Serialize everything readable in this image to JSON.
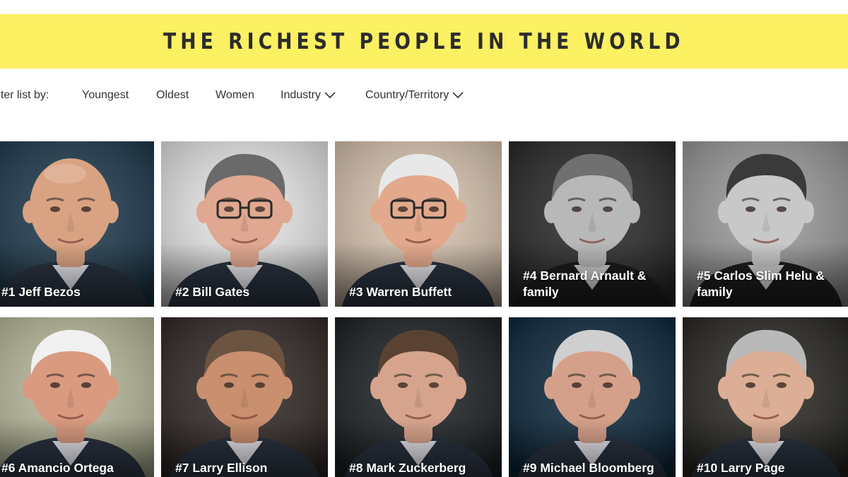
{
  "banner": {
    "title": "THE RICHEST PEOPLE IN THE WORLD",
    "background": "#fcf063"
  },
  "filters": {
    "label": "Filter list by:",
    "items": [
      {
        "label": "Youngest",
        "icon": ""
      },
      {
        "label": "Oldest",
        "icon": ""
      },
      {
        "label": "Women",
        "icon": ""
      },
      {
        "label": "Industry",
        "icon": "chevron-down-icon"
      },
      {
        "label": "Country/Territory",
        "icon": "chevron-down-icon"
      }
    ]
  },
  "people": [
    {
      "label": "#1 Jeff Bezos",
      "bg": "#1f3a4d",
      "skin": "#d9a383",
      "hair": "none",
      "glasses": false,
      "mono": false
    },
    {
      "label": "#2 Bill Gates",
      "bg": "#e6e6e6",
      "skin": "#e0a890",
      "hair": "#6a6a6a",
      "glasses": true,
      "mono": false
    },
    {
      "label": "#3 Warren Buffett",
      "bg": "#d8c4b0",
      "skin": "#e3a98d",
      "hair": "#e8e8e8",
      "glasses": true,
      "mono": false
    },
    {
      "label": "#4 Bernard Arnault & family",
      "bg": "#2a2a2a",
      "skin": "#b8b8b8",
      "hair": "#707070",
      "glasses": false,
      "mono": true
    },
    {
      "label": "#5 Carlos Slim Helu & family",
      "bg": "#9a9a9a",
      "skin": "#c8c8c8",
      "hair": "#3a3a3a",
      "glasses": false,
      "mono": true
    },
    {
      "label": "#6 Amancio Ortega",
      "bg": "#b7b79a",
      "skin": "#d99a80",
      "hair": "#f0f0f0",
      "glasses": false,
      "mono": false
    },
    {
      "label": "#7 Larry Ellison",
      "bg": "#332a27",
      "skin": "#c98f6e",
      "hair": "#6b5440",
      "glasses": false,
      "mono": false
    },
    {
      "label": "#8 Mark Zuckerberg",
      "bg": "#1e2226",
      "skin": "#d6a48c",
      "hair": "#5a4232",
      "glasses": false,
      "mono": false
    },
    {
      "label": "#9 Michael Bloomberg",
      "bg": "#0f2a3f",
      "skin": "#d5a08a",
      "hair": "#cfcfcf",
      "glasses": false,
      "mono": false
    },
    {
      "label": "#10 Larry Page",
      "bg": "#2b2925",
      "skin": "#dcae95",
      "hair": "#b9b9b9",
      "glasses": false,
      "mono": false
    }
  ]
}
